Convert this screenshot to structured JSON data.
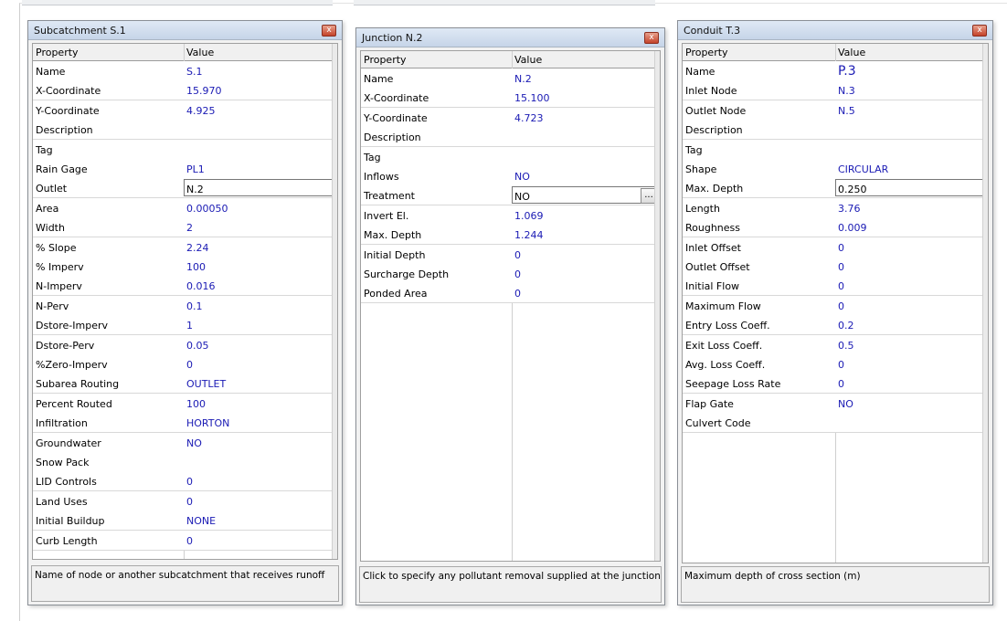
{
  "subcatchment": {
    "title": "Subcatchment S.1",
    "close": "x",
    "header": {
      "property": "Property",
      "value": "Value"
    },
    "rows": [
      {
        "p": "Name",
        "v": "S.1"
      },
      {
        "p": "X-Coordinate",
        "v": "15.970"
      },
      {
        "p": "Y-Coordinate",
        "v": "4.925"
      },
      {
        "p": "Description",
        "v": ""
      },
      {
        "p": "Tag",
        "v": ""
      },
      {
        "p": "Rain Gage",
        "v": "PL1"
      },
      {
        "p": "Outlet",
        "v": "N.2"
      },
      {
        "p": "Area",
        "v": "0.00050"
      },
      {
        "p": "Width",
        "v": "2"
      },
      {
        "p": "% Slope",
        "v": "2.24"
      },
      {
        "p": "% Imperv",
        "v": "100"
      },
      {
        "p": "N-Imperv",
        "v": "0.016"
      },
      {
        "p": "N-Perv",
        "v": "0.1"
      },
      {
        "p": "Dstore-Imperv",
        "v": "1"
      },
      {
        "p": "Dstore-Perv",
        "v": "0.05"
      },
      {
        "p": "%Zero-Imperv",
        "v": "0"
      },
      {
        "p": "Subarea Routing",
        "v": "OUTLET"
      },
      {
        "p": "Percent Routed",
        "v": "100"
      },
      {
        "p": "Infiltration",
        "v": "HORTON"
      },
      {
        "p": "Groundwater",
        "v": "NO"
      },
      {
        "p": "Snow Pack",
        "v": ""
      },
      {
        "p": "LID Controls",
        "v": "0"
      },
      {
        "p": "Land Uses",
        "v": "0"
      },
      {
        "p": "Initial Buildup",
        "v": "NONE"
      },
      {
        "p": "Curb Length",
        "v": "0"
      }
    ],
    "description": "Name of node or another subcatchment that receives runoff"
  },
  "junction": {
    "title": "Junction N.2",
    "close": "x",
    "header": {
      "property": "Property",
      "value": "Value"
    },
    "rows": [
      {
        "p": "Name",
        "v": "N.2"
      },
      {
        "p": "X-Coordinate",
        "v": "15.100"
      },
      {
        "p": "Y-Coordinate",
        "v": "4.723"
      },
      {
        "p": "Description",
        "v": ""
      },
      {
        "p": "Tag",
        "v": ""
      },
      {
        "p": "Inflows",
        "v": "NO"
      },
      {
        "p": "Treatment",
        "v": "NO"
      },
      {
        "p": "Invert El.",
        "v": "1.069"
      },
      {
        "p": "Max. Depth",
        "v": "1.244"
      },
      {
        "p": "Initial Depth",
        "v": "0"
      },
      {
        "p": "Surcharge Depth",
        "v": "0"
      },
      {
        "p": "Ponded Area",
        "v": "0"
      }
    ],
    "browse_button": "...",
    "description": "Click to specify any pollutant removal supplied at the junction"
  },
  "conduit": {
    "title": "Conduit T.3",
    "close": "x",
    "header": {
      "property": "Property",
      "value": "Value"
    },
    "rows": [
      {
        "p": "Name",
        "v": "P.3"
      },
      {
        "p": "Inlet Node",
        "v": "N.3"
      },
      {
        "p": "Outlet Node",
        "v": "N.5"
      },
      {
        "p": "Description",
        "v": ""
      },
      {
        "p": "Tag",
        "v": ""
      },
      {
        "p": "Shape",
        "v": "CIRCULAR"
      },
      {
        "p": "Max. Depth",
        "v": "0.250"
      },
      {
        "p": "Length",
        "v": "3.76"
      },
      {
        "p": "Roughness",
        "v": "0.009"
      },
      {
        "p": "Inlet Offset",
        "v": "0"
      },
      {
        "p": "Outlet Offset",
        "v": "0"
      },
      {
        "p": "Initial Flow",
        "v": "0"
      },
      {
        "p": "Maximum Flow",
        "v": "0"
      },
      {
        "p": "Entry Loss Coeff.",
        "v": "0.2"
      },
      {
        "p": "Exit Loss Coeff.",
        "v": "0.5"
      },
      {
        "p": "Avg. Loss Coeff.",
        "v": "0"
      },
      {
        "p": "Seepage Loss Rate",
        "v": "0"
      },
      {
        "p": "Flap Gate",
        "v": "NO"
      },
      {
        "p": "Culvert Code",
        "v": ""
      }
    ],
    "description": "Maximum depth of cross section (m)"
  }
}
